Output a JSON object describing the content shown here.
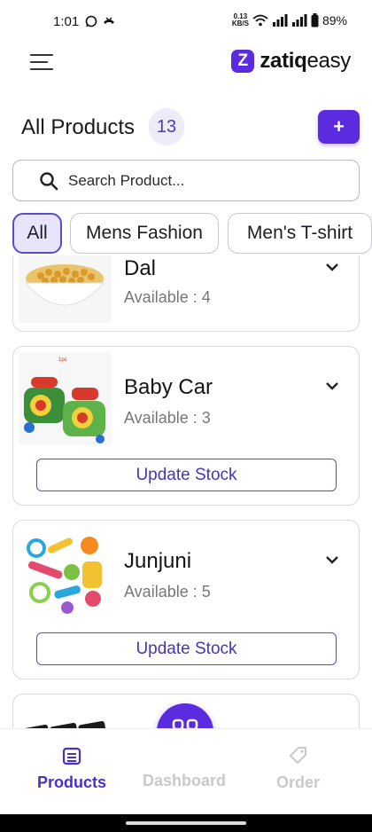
{
  "status_bar": {
    "time": "1:01",
    "net_speed_value": "0.13",
    "net_speed_unit": "KB/S",
    "battery": "89%"
  },
  "header": {
    "brand_name_bold": "zatiq",
    "brand_name_light": "easy",
    "brand_letter": "Z"
  },
  "page": {
    "title": "All Products",
    "count": "13",
    "add_label": "+"
  },
  "search": {
    "placeholder": "Search Product..."
  },
  "categories": [
    {
      "label": "All",
      "active": true
    },
    {
      "label": "Mens Fashion",
      "active": false
    },
    {
      "label": "Men's T-shirt",
      "active": false
    }
  ],
  "products": [
    {
      "name": "Dal",
      "availability": "Available : 4",
      "update_label": ""
    },
    {
      "name": "Baby Car",
      "availability": "Available : 3",
      "update_label": "Update Stock",
      "thumb_caption": "1pc"
    },
    {
      "name": "Junjuni",
      "availability": "Available : 5",
      "update_label": "Update Stock"
    }
  ],
  "bottom_nav": {
    "items": [
      {
        "label": "Products",
        "icon": "archive-box-icon",
        "active": true
      },
      {
        "label": "Dashboard",
        "icon": "grid-icon",
        "active": false
      },
      {
        "label": "Order",
        "icon": "tag-icon",
        "active": false
      }
    ]
  },
  "colors": {
    "accent": "#5b2be0",
    "accent_dark": "#4a2fcf",
    "badge_bg": "#ecebf7",
    "inactive_nav": "#c9c9cc"
  }
}
